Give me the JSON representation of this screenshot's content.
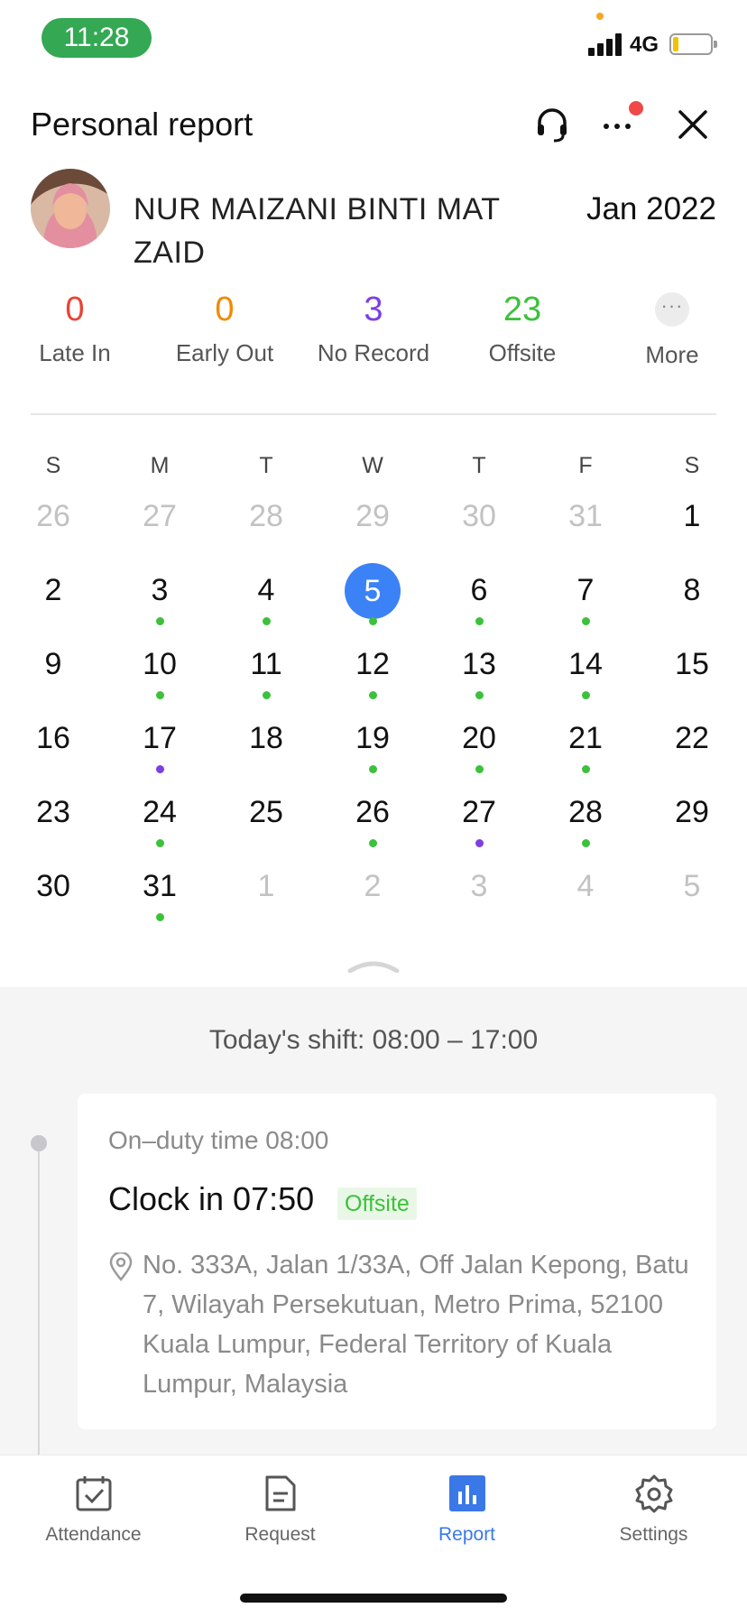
{
  "status_bar": {
    "time": "11:28",
    "network": "4G"
  },
  "header": {
    "title": "Personal report",
    "icons": [
      "headset-icon",
      "more-icon",
      "close-icon"
    ]
  },
  "profile": {
    "name": "NUR MAIZANI BINTI MAT ZAID",
    "month": "Jan 2022"
  },
  "stats": [
    {
      "value": "0",
      "label": "Late In",
      "color": "#ea4335"
    },
    {
      "value": "0",
      "label": "Early Out",
      "color": "#f08a00"
    },
    {
      "value": "3",
      "label": "No Record",
      "color": "#7b3fe4"
    },
    {
      "value": "23",
      "label": "Offsite",
      "color": "#3cc13b"
    },
    {
      "value": "···",
      "label": "More",
      "color": "#888888"
    }
  ],
  "calendar": {
    "weekdays": [
      "S",
      "M",
      "T",
      "W",
      "T",
      "F",
      "S"
    ],
    "weeks": [
      [
        {
          "d": "26",
          "m": 1
        },
        {
          "d": "27",
          "m": 1
        },
        {
          "d": "28",
          "m": 1
        },
        {
          "d": "29",
          "m": 1
        },
        {
          "d": "30",
          "m": 1
        },
        {
          "d": "31",
          "m": 1
        },
        {
          "d": "1"
        }
      ],
      [
        {
          "d": "2"
        },
        {
          "d": "3",
          "dot": "green"
        },
        {
          "d": "4",
          "dot": "green"
        },
        {
          "d": "5",
          "dot": "green",
          "sel": 1
        },
        {
          "d": "6",
          "dot": "green"
        },
        {
          "d": "7",
          "dot": "green"
        },
        {
          "d": "8"
        }
      ],
      [
        {
          "d": "9"
        },
        {
          "d": "10",
          "dot": "green"
        },
        {
          "d": "11",
          "dot": "green"
        },
        {
          "d": "12",
          "dot": "green"
        },
        {
          "d": "13",
          "dot": "green"
        },
        {
          "d": "14",
          "dot": "green"
        },
        {
          "d": "15"
        }
      ],
      [
        {
          "d": "16"
        },
        {
          "d": "17",
          "dot": "purple"
        },
        {
          "d": "18"
        },
        {
          "d": "19",
          "dot": "green"
        },
        {
          "d": "20",
          "dot": "green"
        },
        {
          "d": "21",
          "dot": "green"
        },
        {
          "d": "22"
        }
      ],
      [
        {
          "d": "23"
        },
        {
          "d": "24",
          "dot": "green"
        },
        {
          "d": "25"
        },
        {
          "d": "26",
          "dot": "green"
        },
        {
          "d": "27",
          "dot": "purple"
        },
        {
          "d": "28",
          "dot": "green"
        },
        {
          "d": "29"
        }
      ],
      [
        {
          "d": "30"
        },
        {
          "d": "31",
          "dot": "green"
        },
        {
          "d": "1",
          "m": 1
        },
        {
          "d": "2",
          "m": 1
        },
        {
          "d": "3",
          "m": 1
        },
        {
          "d": "4",
          "m": 1
        },
        {
          "d": "5",
          "m": 1
        }
      ]
    ],
    "selected_day": "5"
  },
  "shift": {
    "text": "Today's shift: 08:00 – 17:00"
  },
  "record": {
    "on_duty": "On–duty time 08:00",
    "clock_in": "Clock in 07:50",
    "tag": "Offsite",
    "address": "No. 333A, Jalan 1/33A, Off Jalan Kepong, Batu 7, Wilayah Persekutuan, Metro Prima, 52100 Kuala Lumpur, Federal Territory of Kuala Lumpur, Malaysia"
  },
  "tabs": [
    {
      "label": "Attendance",
      "icon": "calendar-check-icon",
      "active": false
    },
    {
      "label": "Request",
      "icon": "document-icon",
      "active": false
    },
    {
      "label": "Report",
      "icon": "bar-chart-icon",
      "active": true
    },
    {
      "label": "Settings",
      "icon": "gear-icon",
      "active": false
    }
  ],
  "colors": {
    "accent": "#3a78e8",
    "selected_day": "#3b82f6",
    "green": "#3cc13b",
    "purple": "#7b3fe4"
  }
}
